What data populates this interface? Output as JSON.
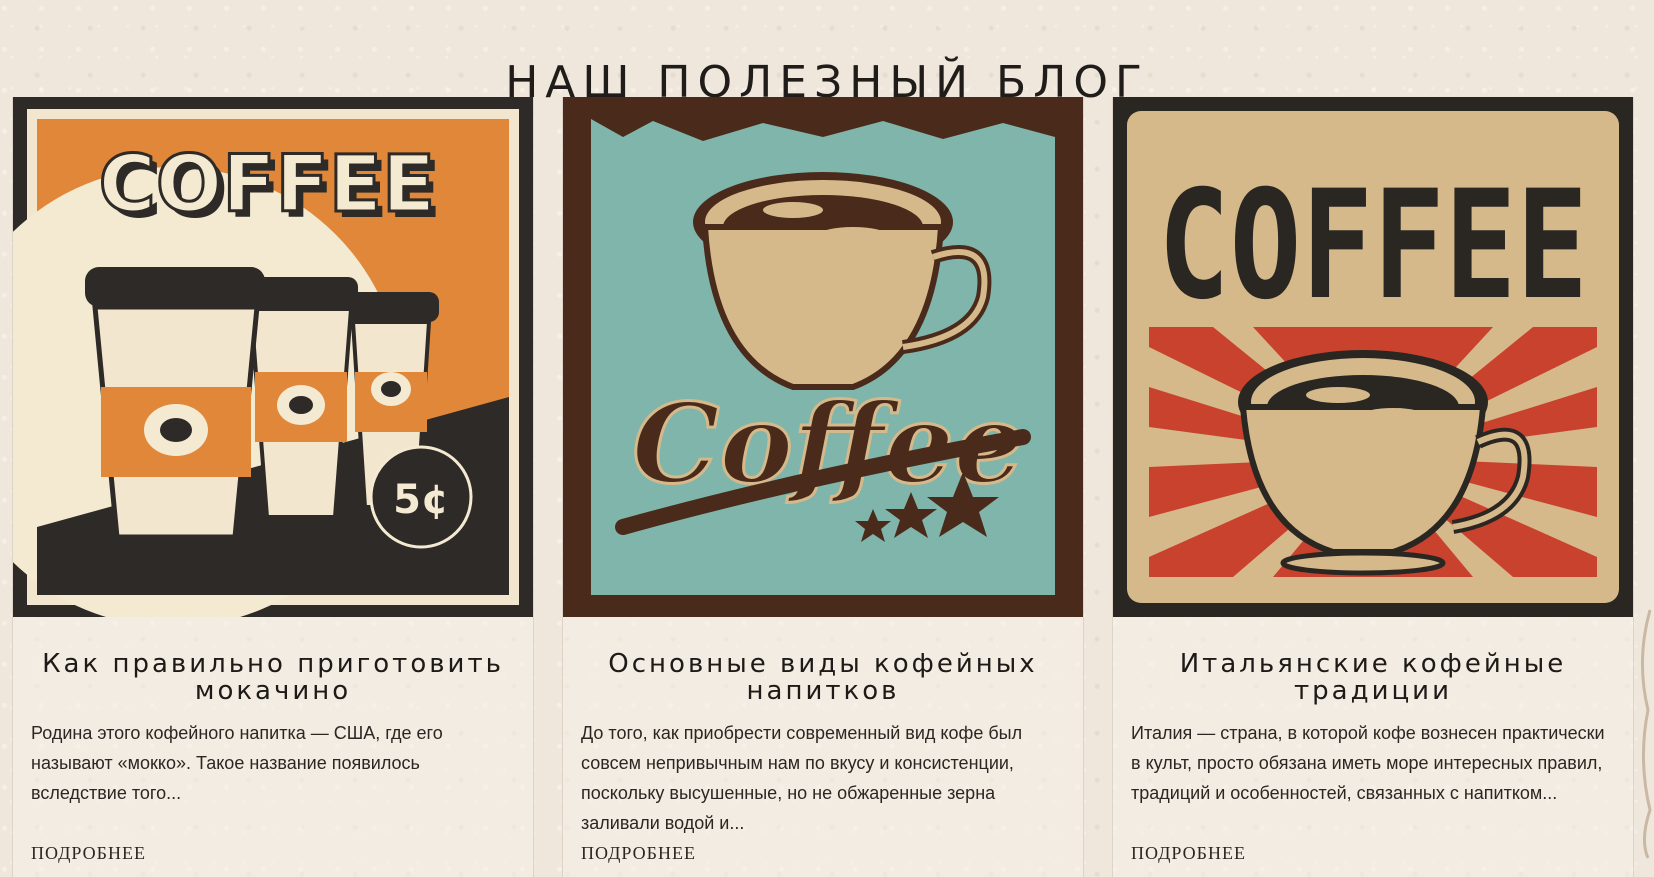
{
  "section_title": "НАШ ПОЛЕЗНЫЙ БЛОГ",
  "posts": [
    {
      "image_text": "COFFEE",
      "image_badge": "5¢",
      "title": "Как правильно приготовить мокачино",
      "excerpt": "Родина этого кофейного напитка — США, где его называют «мокко». Такое название появилось вследствие того...",
      "more": "ПОДРОБНЕЕ"
    },
    {
      "image_text": "Coffee",
      "title": "Основные виды кофейных напитков",
      "excerpt": "До того, как приобрести современный вид кофе был совсем непривычным нам по вкусу и консистенции, поскольку высушенные, но не обжаренные зерна заливали водой и...",
      "more": "ПОДРОБНЕЕ"
    },
    {
      "image_text": "COFFEE",
      "title": "Итальянские кофейные традиции",
      "excerpt": "Италия — страна, в которой кофе вознесен практически в культ, просто обязана иметь море интересных правил, традиций и особенностей, связанных с напитком...",
      "more": "ПОДРОБНЕЕ"
    }
  ],
  "colors": {
    "background": "#efe7dc",
    "orange": "#e0873a",
    "teal": "#7fb5aa",
    "brown": "#4a2a1a",
    "red": "#c8422e",
    "tan": "#d6b98a"
  }
}
